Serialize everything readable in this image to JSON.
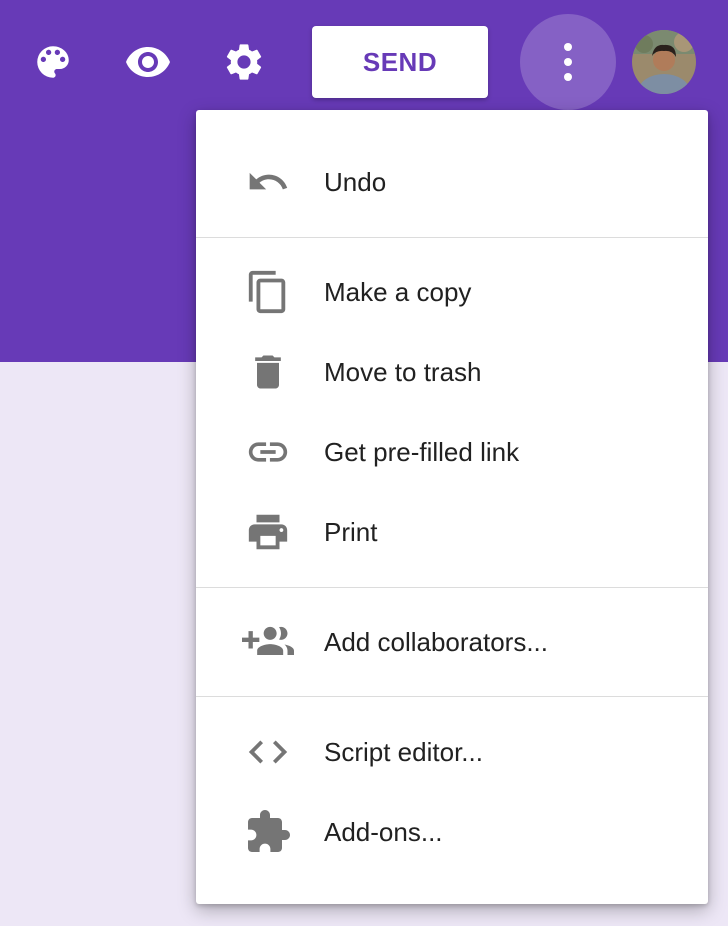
{
  "toolbar": {
    "send_label": "SEND",
    "icons": [
      "palette-icon",
      "eye-icon",
      "gear-icon",
      "more-vert-icon"
    ]
  },
  "colors": {
    "header": "#673ab7",
    "page_background": "#ede7f6",
    "menu_text": "#212121",
    "menu_icon": "#757575"
  },
  "menu": {
    "items": [
      {
        "label": "Undo",
        "icon": "undo-icon"
      },
      {
        "label": "Make a copy",
        "icon": "copy-icon"
      },
      {
        "label": "Move to trash",
        "icon": "trash-icon"
      },
      {
        "label": "Get pre-filled link",
        "icon": "link-icon"
      },
      {
        "label": "Print",
        "icon": "print-icon"
      },
      {
        "label": "Add collaborators...",
        "icon": "add-people-icon"
      },
      {
        "label": "Script editor...",
        "icon": "code-icon"
      },
      {
        "label": "Add-ons...",
        "icon": "puzzle-icon"
      }
    ]
  }
}
